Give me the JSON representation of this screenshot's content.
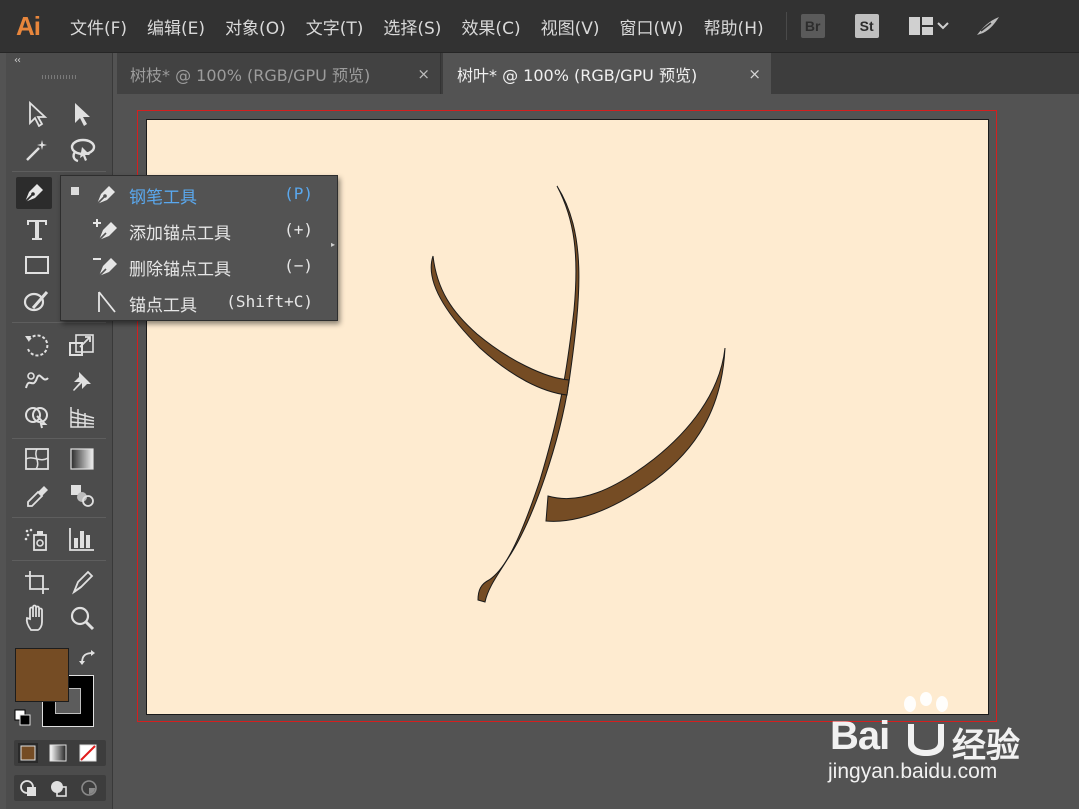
{
  "app": {
    "logo": "Ai"
  },
  "menu": [
    "文件(F)",
    "编辑(E)",
    "对象(O)",
    "文字(T)",
    "选择(S)",
    "效果(C)",
    "视图(V)",
    "窗口(W)",
    "帮助(H)"
  ],
  "app_switcher": {
    "bridge": "Br",
    "stock": "St"
  },
  "tabs": [
    {
      "title": "树枝* @ 100% (RGB/GPU 预览)",
      "close": "×",
      "active": false
    },
    {
      "title": "树叶* @ 100% (RGB/GPU 预览)",
      "close": "×",
      "active": true
    }
  ],
  "toolbar": {
    "collapse": "‹‹",
    "tools": [
      "selection-tool",
      "direct-selection-tool",
      "magic-wand-tool",
      "lasso-tool",
      "pen-tool",
      "curvature-tool",
      "type-tool",
      "rectangle-tool",
      "paintbrush-tool",
      "rotate-tool",
      "scale-tool",
      "warp-tool",
      "puppet-warp-tool",
      "shape-builder-tool",
      "perspective-grid-tool",
      "mesh-tool",
      "gradient-tool",
      "eyedropper-tool",
      "blend-tool",
      "symbol-sprayer-tool",
      "column-graph-tool",
      "artboard-tool",
      "slice-tool",
      "hand-tool",
      "zoom-tool"
    ],
    "active_tool": "pen-tool",
    "fill_color": "#754c24",
    "stroke_color": "#000000"
  },
  "flyout": {
    "items": [
      {
        "label": "钢笔工具",
        "shortcut": "(P)",
        "selected": true,
        "icon": "pen-icon"
      },
      {
        "label": "添加锚点工具",
        "shortcut": "(+)",
        "selected": false,
        "icon": "add-anchor-icon"
      },
      {
        "label": "删除锚点工具",
        "shortcut": "(−)",
        "selected": false,
        "icon": "delete-anchor-icon"
      },
      {
        "label": "锚点工具",
        "shortcut": "(Shift+C)",
        "selected": false,
        "icon": "anchor-point-icon"
      }
    ]
  },
  "artwork": {
    "branch_fill": "#754c24",
    "artboard_bg": "#feebd0",
    "bleed_color": "#d41f1f"
  },
  "watermark": {
    "brand": "Bai",
    "brand_cn": "经验",
    "url": "jingyan.baidu.com"
  }
}
